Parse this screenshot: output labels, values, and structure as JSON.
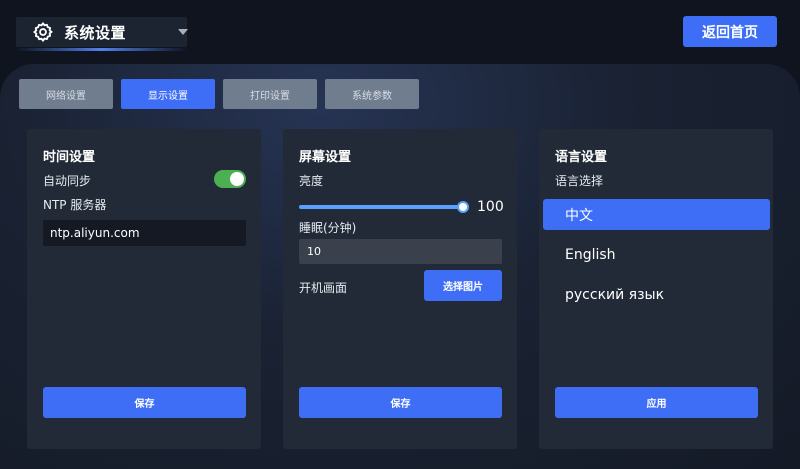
{
  "header": {
    "title": "系统设置",
    "home_label": "返回首页"
  },
  "tabs": [
    {
      "label": "网络设置",
      "active": false
    },
    {
      "label": "显示设置",
      "active": true
    },
    {
      "label": "打印设置",
      "active": false
    },
    {
      "label": "系统参数",
      "active": false
    }
  ],
  "time_panel": {
    "title": "时间设置",
    "auto_sync_label": "自动同步",
    "auto_sync_on": true,
    "ntp_label": "NTP 服务器",
    "ntp_value": "ntp.aliyun.com",
    "save_label": "保存"
  },
  "screen_panel": {
    "title": "屏幕设置",
    "brightness_label": "亮度",
    "brightness_value": "100",
    "sleep_label": "睡眠(分钟)",
    "sleep_value": "10",
    "boot_screen_label": "开机画面",
    "pick_image_label": "选择图片",
    "save_label": "保存"
  },
  "lang_panel": {
    "title": "语言设置",
    "select_label": "语言选择",
    "options": [
      {
        "label": "中文",
        "selected": true
      },
      {
        "label": "English",
        "selected": false
      },
      {
        "label": "русский язык",
        "selected": false
      }
    ],
    "apply_label": "应用"
  },
  "colors": {
    "accent": "#3d6ef5",
    "toggle_on": "#4caf50",
    "panel_bg": "#222a38",
    "page_bg": "#0f141f"
  },
  "icons": {
    "title_icon": "gear-icon",
    "dropdown_icon": "caret-down-icon"
  }
}
